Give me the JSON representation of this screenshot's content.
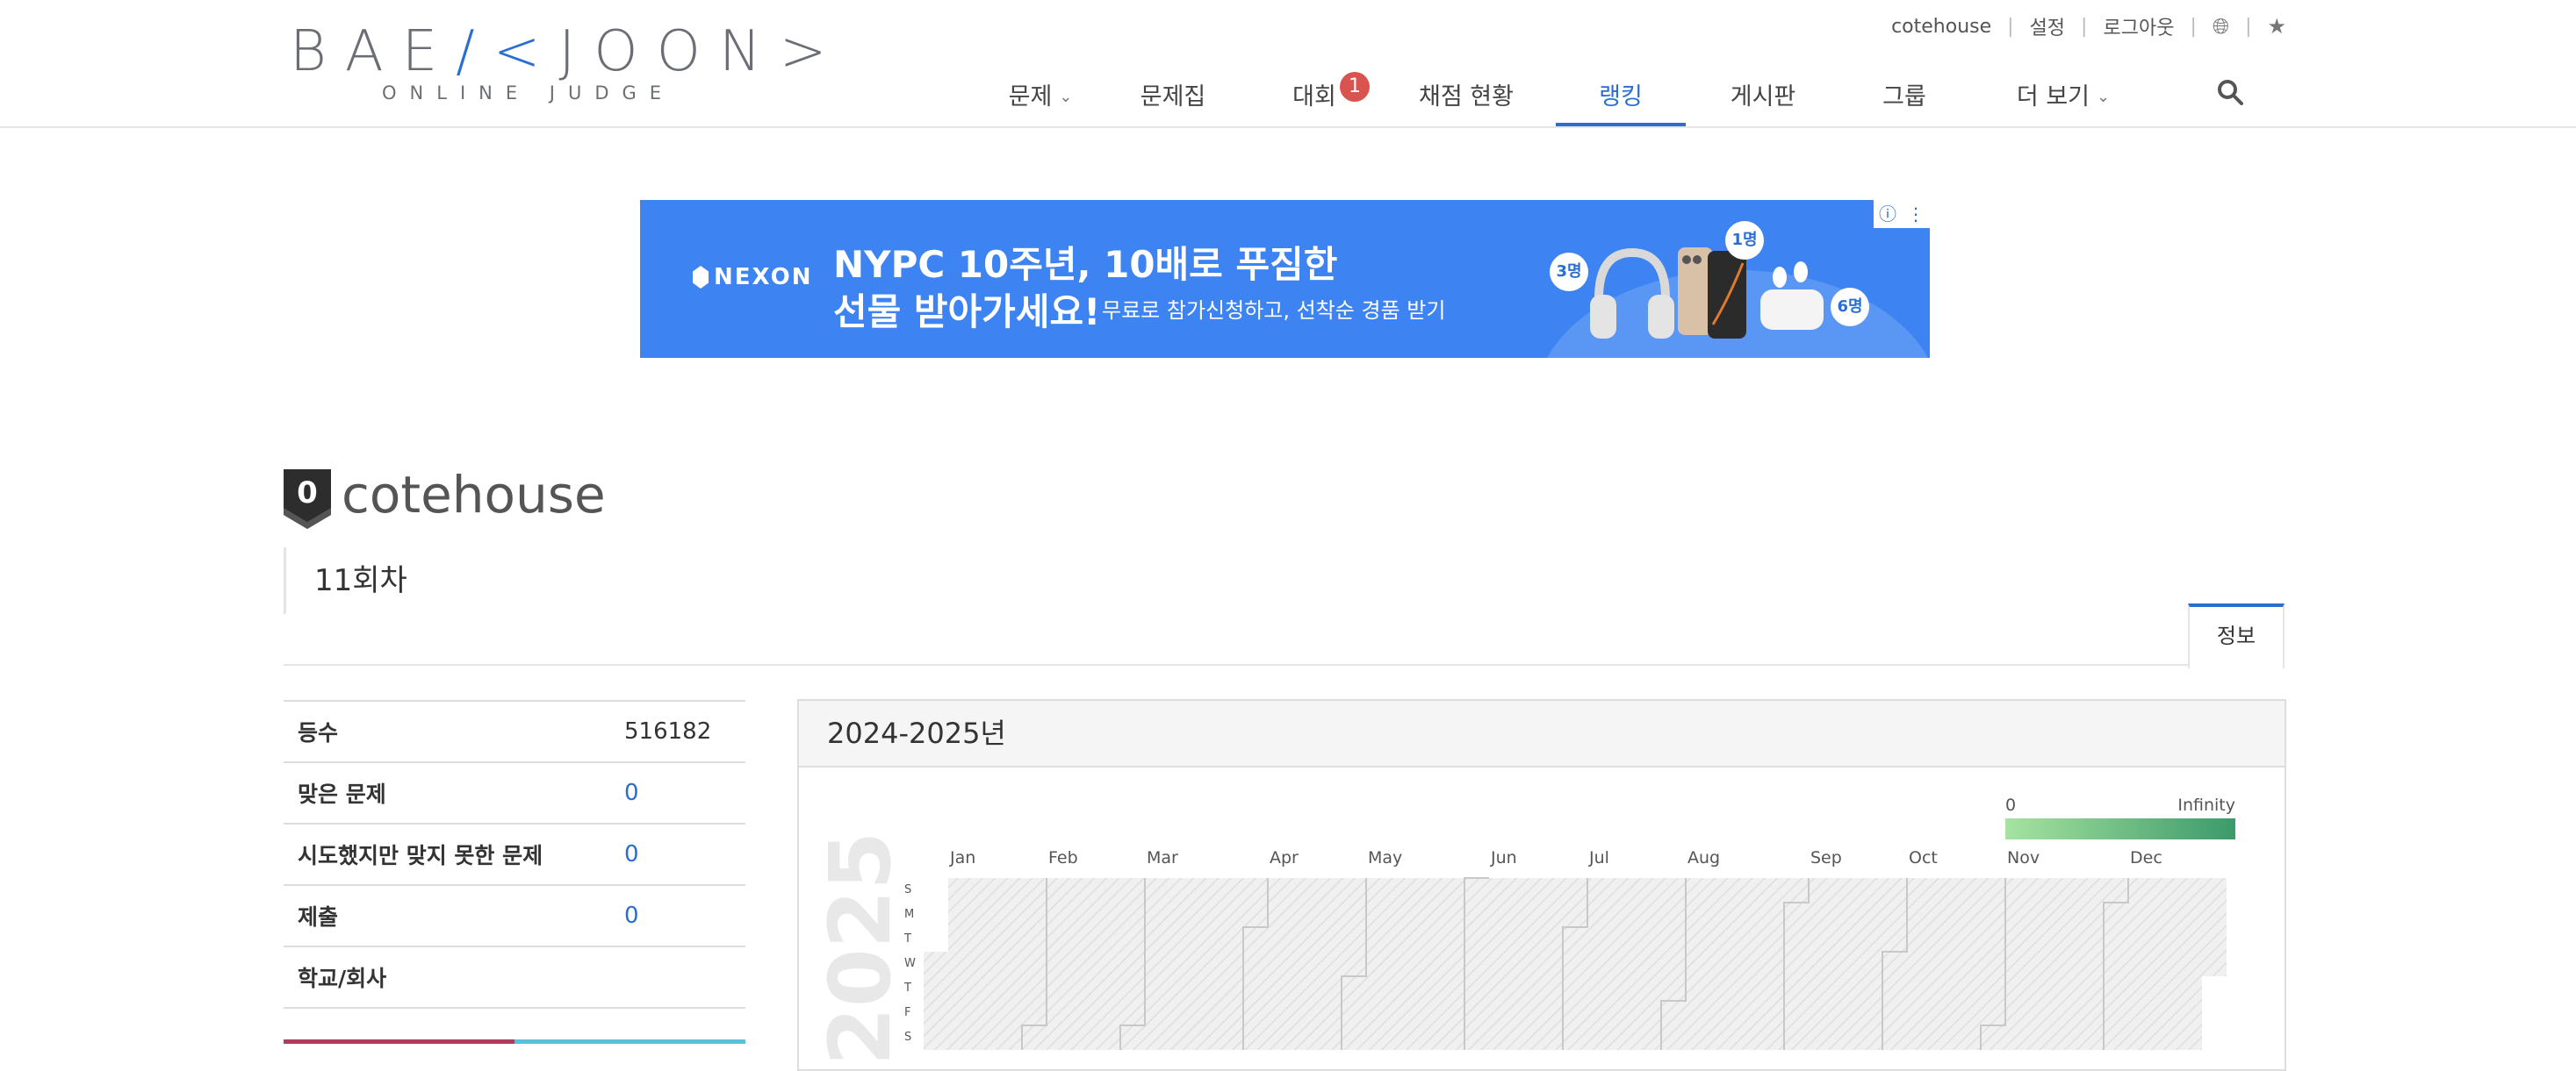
{
  "header": {
    "logo_main_pre": "BAE",
    "logo_main_k": "/<",
    "logo_main_post": "JOON>",
    "logo_sub": "ONLINE JUDGE",
    "top_links": {
      "user": "cotehouse",
      "settings": "설정",
      "logout": "로그아웃"
    },
    "nav": [
      {
        "label": "문제",
        "has_dropdown": true
      },
      {
        "label": "문제집"
      },
      {
        "label": "대회",
        "badge": "1"
      },
      {
        "label": "채점 현황"
      },
      {
        "label": "랭킹",
        "active": true
      },
      {
        "label": "게시판"
      },
      {
        "label": "그룹"
      },
      {
        "label": "더 보기",
        "has_dropdown": true
      }
    ]
  },
  "ad": {
    "brand": "NEXON",
    "line1": "NYPC 10주년, 10배로 푸짐한",
    "line2": "선물 받아가세요!",
    "line3": "무료로 참가신청하고, 선착순 경품 받기",
    "bubbles": [
      "3명",
      "1명",
      "6명"
    ]
  },
  "profile": {
    "tier": "0",
    "username": "cotehouse",
    "motto": "11회차",
    "tab": "정보"
  },
  "stats": [
    {
      "key": "등수",
      "value": "516182",
      "link": false
    },
    {
      "key": "맞은 문제",
      "value": "0",
      "link": true
    },
    {
      "key": "시도했지만 맞지 못한 문제",
      "value": "0",
      "link": true
    },
    {
      "key": "제출",
      "value": "0",
      "link": true
    },
    {
      "key": "학교/회사",
      "value": "",
      "link": false
    }
  ],
  "heatmap": {
    "title": "2024-2025년",
    "year": "2025",
    "legend_min": "0",
    "legend_max": "Infinity",
    "months": [
      "Jan",
      "Feb",
      "Mar",
      "Apr",
      "May",
      "Jun",
      "Jul",
      "Aug",
      "Sep",
      "Oct",
      "Nov",
      "Dec"
    ],
    "days": [
      "S",
      "M",
      "T",
      "W",
      "T",
      "F",
      "S"
    ]
  },
  "colors": {
    "accent": "#2a6fd0",
    "badge": "#d9534f",
    "ad_bg": "#3d83f2"
  }
}
